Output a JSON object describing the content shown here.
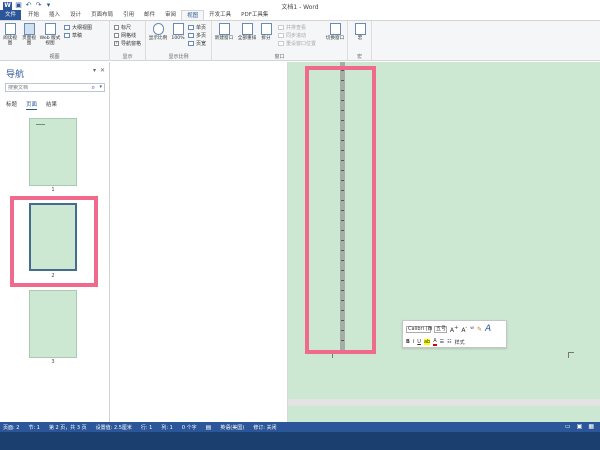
{
  "titlebar": {
    "logo": "W",
    "title": "文档1 - Word"
  },
  "tabs": [
    "文件",
    "开始",
    "插入",
    "设计",
    "页面布局",
    "引用",
    "邮件",
    "审阅",
    "视图",
    "开发工具",
    "PDF工具集"
  ],
  "active_tab": "视图",
  "ribbon": {
    "views": {
      "read": "阅读视图",
      "print": "页面视图",
      "web": "Web 版式视图",
      "outline": "大纲视图",
      "draft": "草稿",
      "label": "视图"
    },
    "show": {
      "ruler": "标尺",
      "gridlines": "网格线",
      "navpane": "导航窗格",
      "label": "显示"
    },
    "zoom": {
      "zoom": "显示比例",
      "pct": "100%",
      "one": "单页",
      "multi": "多页",
      "width": "页宽",
      "label": "显示比例"
    },
    "window": {
      "new": "新建窗口",
      "arrange": "全部重排",
      "split": "拆分",
      "side": "并排查看",
      "sync": "同步滚动",
      "reset": "重设窗口位置",
      "switch": "切换窗口",
      "label": "窗口"
    },
    "macro": {
      "macros": "宏",
      "label": "宏"
    }
  },
  "nav": {
    "title": "导航",
    "search_placeholder": "搜索文档",
    "tabs": [
      "标题",
      "页面",
      "结果"
    ],
    "active": "页面",
    "pages": [
      "1",
      "2",
      "3"
    ]
  },
  "mini": {
    "font": "Calibri (西",
    "size": "五号",
    "styles": "样式"
  },
  "status": {
    "page": "页面: 2",
    "section": "节: 1",
    "pageof": "第 2 页，共 3 页",
    "setting": "设置值: 2.5厘米",
    "row": "行: 1",
    "col": "列: 1",
    "words": "0 个字",
    "lang": "英语(美国)",
    "track": "修订: 关闭"
  },
  "colors": {
    "accent": "#2b579a",
    "page": "#cde8d2",
    "highlight": "#f06a8e"
  }
}
